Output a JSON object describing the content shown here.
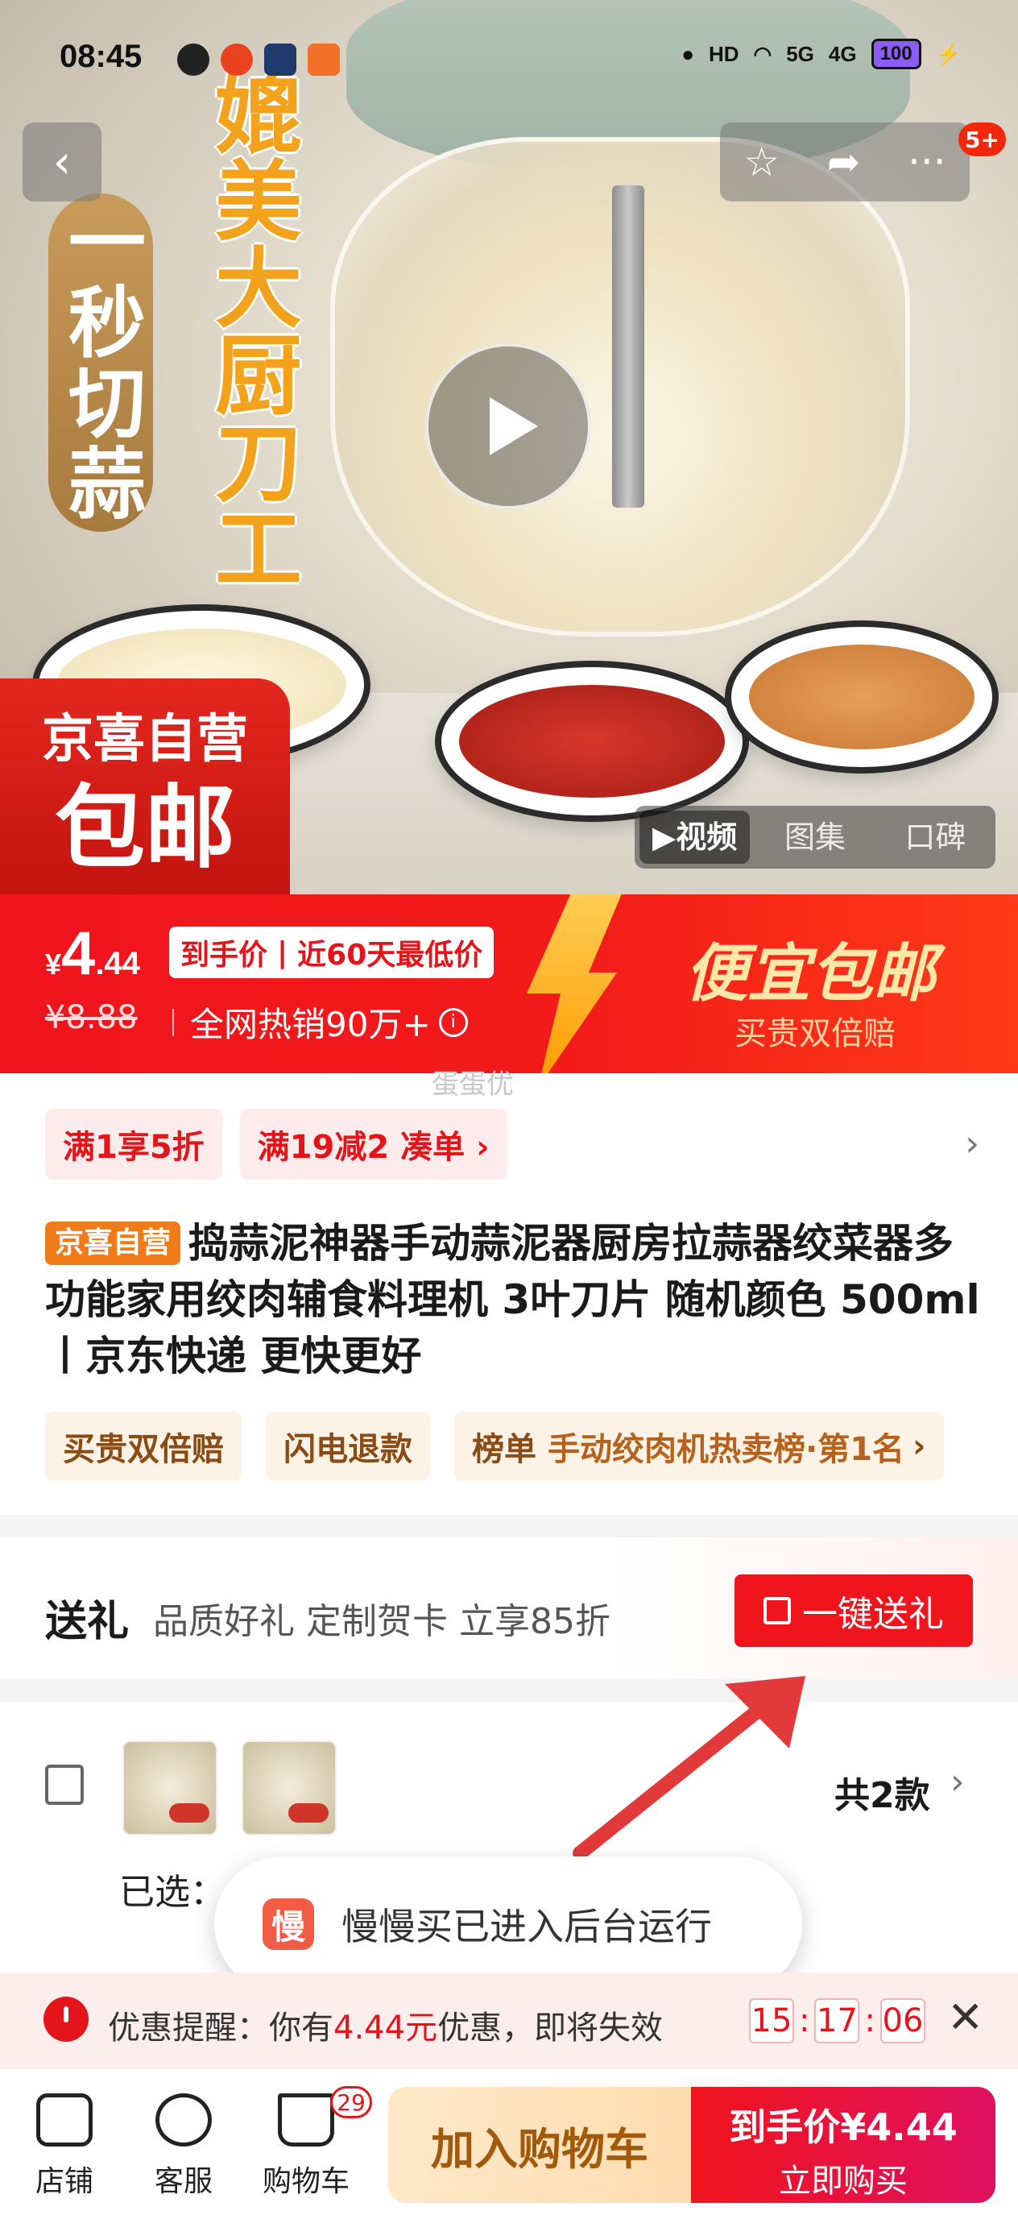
{
  "status_bar": {
    "time": "08:45",
    "hd_label": "HD",
    "net1": "5G",
    "net2": "4G",
    "battery": "100"
  },
  "top_bar": {
    "back_icon": "chevron-left-icon",
    "favorite_icon": "star-icon",
    "share_icon": "share-icon",
    "more_icon": "more-icon",
    "more_symbol": "···",
    "notification_badge": "5+"
  },
  "hero": {
    "vertical_left": "一秒切蒜",
    "vertical_right": "媲美大厨刀工",
    "promo_line1": "京喜自营",
    "promo_line2": "包邮",
    "media_tabs": [
      {
        "label": "▶视频",
        "active": true
      },
      {
        "label": "图集",
        "active": false
      },
      {
        "label": "口碑",
        "active": false
      }
    ]
  },
  "price": {
    "currency": "¥",
    "integer": "4",
    "decimal": ".44",
    "tag_left": "到手价",
    "tag_sep": "|",
    "tag_right": "近60天最低价",
    "original": "¥8.88",
    "hot_sale": "全网热销90万+",
    "info_icon": "i",
    "banner_title": "便宜包邮",
    "banner_sub": "买贵双倍赔"
  },
  "watermark": "蛋蛋优",
  "coupons": {
    "c1": "满1享5折",
    "c2": "满19减2",
    "c2_action": "凑单 ›",
    "arrow": "›"
  },
  "product": {
    "store_tag": "京喜自营",
    "title": "捣蒜泥神器手动蒜泥器厨房拉蒜器绞菜器多功能家用绞肉辅食料理机 3叶刀片 随机颜色 500ml丨京东快递 更快更好"
  },
  "service_tags": {
    "t1": "买贵双倍赔",
    "t2": "闪电退款",
    "t3_prefix": "榜单",
    "t3_text": "手动绞肉机热卖榜·第1名",
    "t3_arrow": "›"
  },
  "gift": {
    "title": "送礼",
    "subtitle": "品质好礼 定制贺卡 立享85折",
    "button": "一键送礼"
  },
  "variants": {
    "count": "共2款",
    "arrow": "›",
    "selected_label": "已选："
  },
  "toast": {
    "icon_char": "慢",
    "message": "慢慢买已进入后台运行"
  },
  "reminder": {
    "prefix": "优惠提醒：你有",
    "amount": "4.44元",
    "suffix": "优惠，即将失效",
    "h": "15",
    "m": "17",
    "s": "06",
    "colon": ":",
    "close": "✕"
  },
  "bottom_bar": {
    "store": "店铺",
    "service": "客服",
    "cart": "购物车",
    "cart_count": "29",
    "add_to_cart": "加入购物车",
    "buy_line1": "到手价¥4.44",
    "buy_line2": "立即购买"
  }
}
